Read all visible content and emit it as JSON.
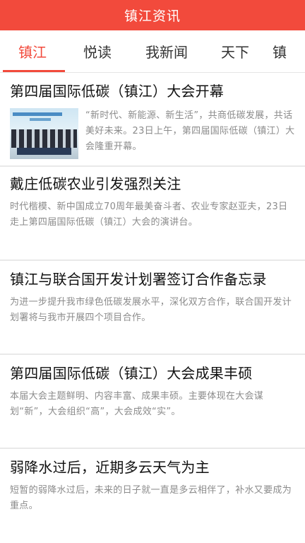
{
  "app": {
    "title": "镇江资讯"
  },
  "tabs": [
    {
      "label": "镇江",
      "active": true
    },
    {
      "label": "悦读"
    },
    {
      "label": "我新闻"
    },
    {
      "label": "天下"
    },
    {
      "label": "镇"
    }
  ],
  "articles": [
    {
      "title": "第四届国际低碳（镇江）大会开幕",
      "summary": "“新时代、新能源、新生活”，共商低碳发展，共话美好未来。23日上午，第四届国际低碳（镇江）大会隆重开幕。",
      "has_thumbnail": true
    },
    {
      "title": "戴庄低碳农业引发强烈关注",
      "summary": "时代楷模、新中国成立70周年最美奋斗者、农业专家赵亚夫，23日走上第四届国际低碳（镇江）大会的演讲台。"
    },
    {
      "title": "镇江与联合国开发计划署签订合作备忘录",
      "summary": "为进一步提升我市绿色低碳发展水平，深化双方合作，联合国开发计划署将与我市开展四个项目合作。"
    },
    {
      "title": "第四届国际低碳（镇江）大会成果丰硕",
      "summary": "本届大会主题鲜明、内容丰富、成果丰硕。主要体现在大会谋划“新”，大会组织“高”，大会成效“实”。"
    },
    {
      "title": "弱降水过后，近期多云天气为主",
      "summary": "短暂的弱降水过后，未来的日子就一直是多云相伴了，补水又要成为重点。"
    }
  ],
  "colors": {
    "accent": "#f24a3c",
    "summary_text": "#8b8b8b"
  }
}
